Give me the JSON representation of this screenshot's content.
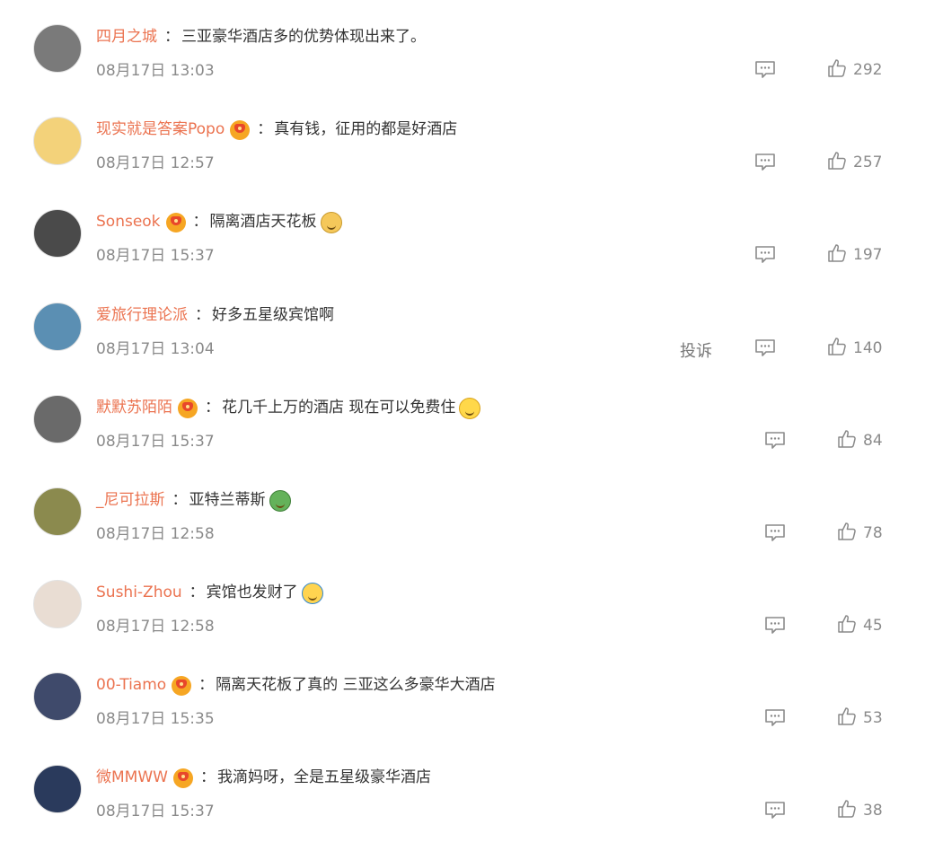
{
  "comments": [
    {
      "username": "四月之城",
      "vip": false,
      "text": "三亚豪华酒店多的优势体现出来了。",
      "emoji": "",
      "time": "08月17日 13:03",
      "likes": "292",
      "show_report": false,
      "avatar_icon": "building-photo-avatar",
      "avatar_color": "#7a7a7a"
    },
    {
      "username": "现实就是答案Popo",
      "vip": true,
      "text": "真有钱，征用的都是好酒店",
      "emoji": "",
      "time": "08月17日 12:57",
      "likes": "257",
      "show_report": false,
      "avatar_icon": "cartoon-avatar",
      "avatar_color": "#f3d27a"
    },
    {
      "username": "Sonseok",
      "vip": true,
      "text": "隔离酒店天花板",
      "emoji": "doge",
      "time": "08月17日 15:37",
      "likes": "197",
      "show_report": false,
      "avatar_icon": "window-photo-avatar",
      "avatar_color": "#4a4a4a"
    },
    {
      "username": "爱旅行理论派",
      "vip": false,
      "text": "好多五星级宾馆啊",
      "emoji": "",
      "time": "08月17日 13:04",
      "likes": "140",
      "show_report": true,
      "report_label": "投诉",
      "avatar_icon": "landscape-avatar",
      "avatar_color": "#5b8fb3"
    },
    {
      "username": "默默苏陌陌",
      "vip": true,
      "text": "花几千上万的酒店 现在可以免费住",
      "emoji": "laugh",
      "time": "08月17日 15:37",
      "likes": "84",
      "show_report": false,
      "avatar_icon": "street-photo-avatar",
      "avatar_color": "#6a6a6a"
    },
    {
      "username": "_尼可拉斯",
      "vip": false,
      "text": "亚特兰蒂斯",
      "emoji": "green",
      "time": "08月17日 12:58",
      "likes": "78",
      "show_report": false,
      "avatar_icon": "map-avatar",
      "avatar_color": "#8b8a4e"
    },
    {
      "username": "Sushi-Zhou",
      "vip": false,
      "text": "宾馆也发财了",
      "emoji": "cry",
      "time": "08月17日 12:58",
      "likes": "45",
      "show_report": false,
      "avatar_icon": "portrait-avatar",
      "avatar_color": "#e9ddd3"
    },
    {
      "username": "00-Tiamo",
      "vip": true,
      "text": "隔离天花板了真的 三亚这么多豪华大酒店",
      "emoji": "",
      "time": "08月17日 15:35",
      "likes": "53",
      "show_report": false,
      "avatar_icon": "sky-photo-avatar",
      "avatar_color": "#3f4a6b"
    },
    {
      "username": "微MMWW",
      "vip": true,
      "text": "我滴妈呀，全是五星级豪华酒店",
      "emoji": "",
      "time": "08月17日 15:37",
      "likes": "38",
      "show_report": false,
      "avatar_icon": "person-photo-avatar",
      "avatar_color": "#2a3a5c"
    }
  ]
}
